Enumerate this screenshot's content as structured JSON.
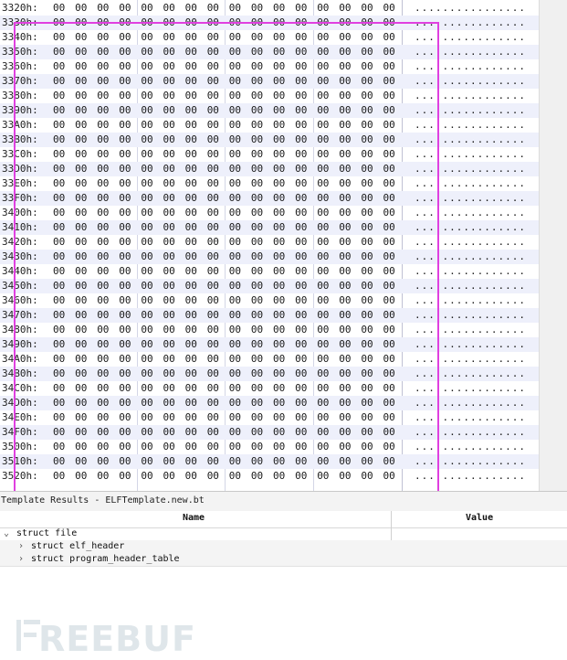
{
  "hex_view": {
    "rows": [
      {
        "offset": "3320h:",
        "ascii": "................"
      },
      {
        "offset": "3330h:",
        "ascii": "................"
      },
      {
        "offset": "3340h:",
        "ascii": "................"
      },
      {
        "offset": "3350h:",
        "ascii": "................"
      },
      {
        "offset": "3360h:",
        "ascii": "................"
      },
      {
        "offset": "3370h:",
        "ascii": "................"
      },
      {
        "offset": "3380h:",
        "ascii": "................"
      },
      {
        "offset": "3390h:",
        "ascii": "................"
      },
      {
        "offset": "33A0h:",
        "ascii": "................"
      },
      {
        "offset": "33B0h:",
        "ascii": "................"
      },
      {
        "offset": "33C0h:",
        "ascii": "................"
      },
      {
        "offset": "33D0h:",
        "ascii": "................"
      },
      {
        "offset": "33E0h:",
        "ascii": "................"
      },
      {
        "offset": "33F0h:",
        "ascii": "................"
      },
      {
        "offset": "3400h:",
        "ascii": "................"
      },
      {
        "offset": "3410h:",
        "ascii": "................"
      },
      {
        "offset": "3420h:",
        "ascii": "................"
      },
      {
        "offset": "3430h:",
        "ascii": "................"
      },
      {
        "offset": "3440h:",
        "ascii": "................"
      },
      {
        "offset": "3450h:",
        "ascii": "................"
      },
      {
        "offset": "3460h:",
        "ascii": "................"
      },
      {
        "offset": "3470h:",
        "ascii": "................"
      },
      {
        "offset": "3480h:",
        "ascii": "................"
      },
      {
        "offset": "3490h:",
        "ascii": "................"
      },
      {
        "offset": "34A0h:",
        "ascii": "................"
      },
      {
        "offset": "34B0h:",
        "ascii": "................"
      },
      {
        "offset": "34C0h:",
        "ascii": "................"
      },
      {
        "offset": "34D0h:",
        "ascii": "................"
      },
      {
        "offset": "34E0h:",
        "ascii": "................"
      },
      {
        "offset": "34F0h:",
        "ascii": "................"
      },
      {
        "offset": "3500h:",
        "ascii": "................"
      },
      {
        "offset": "3510h:",
        "ascii": "................"
      },
      {
        "offset": "3520h:",
        "ascii": "................"
      }
    ],
    "byte_value": "00",
    "bytes_per_row": 16,
    "highlight_color": "#e040e0"
  },
  "template_results": {
    "title": "Template Results - ELFTemplate.new.bt",
    "columns": {
      "name": "Name",
      "value": "Value"
    },
    "tree": [
      {
        "label": "struct file",
        "expanded": true,
        "children": [
          {
            "label": "struct elf_header",
            "value": ""
          },
          {
            "label": "struct program_header_table",
            "value": ""
          }
        ]
      }
    ]
  },
  "watermark": {
    "text": "FREEBUF"
  }
}
